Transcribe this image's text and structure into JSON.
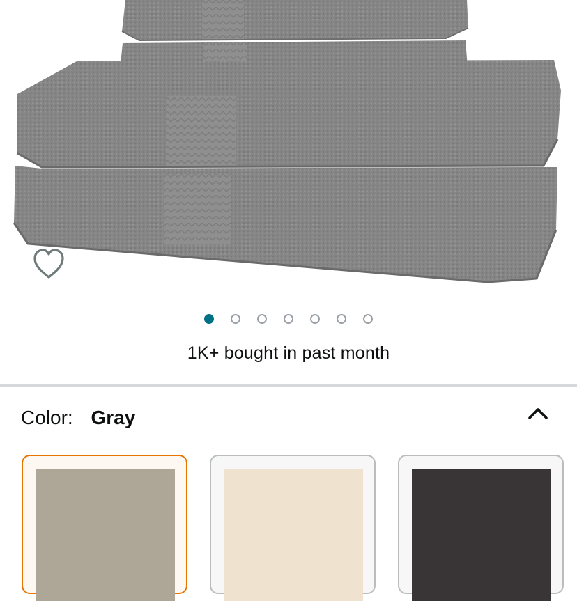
{
  "product": {
    "image_icon": "bath-towel-set-image",
    "towel_color": "#8a8a8a"
  },
  "wishlist": {
    "icon": "heart-outline-icon"
  },
  "gallery": {
    "total": 7,
    "active_index": 0,
    "active_color": "#007185"
  },
  "social_proof": {
    "text": "1K+ bought in past month"
  },
  "color_selector": {
    "label": "Color:",
    "selected": "Gray",
    "collapse_icon": "chevron-up-icon",
    "swatches": [
      {
        "color": "#aea697",
        "selected": true
      },
      {
        "color": "#efe2cf",
        "selected": false
      },
      {
        "color": "#393536",
        "selected": false
      }
    ]
  }
}
